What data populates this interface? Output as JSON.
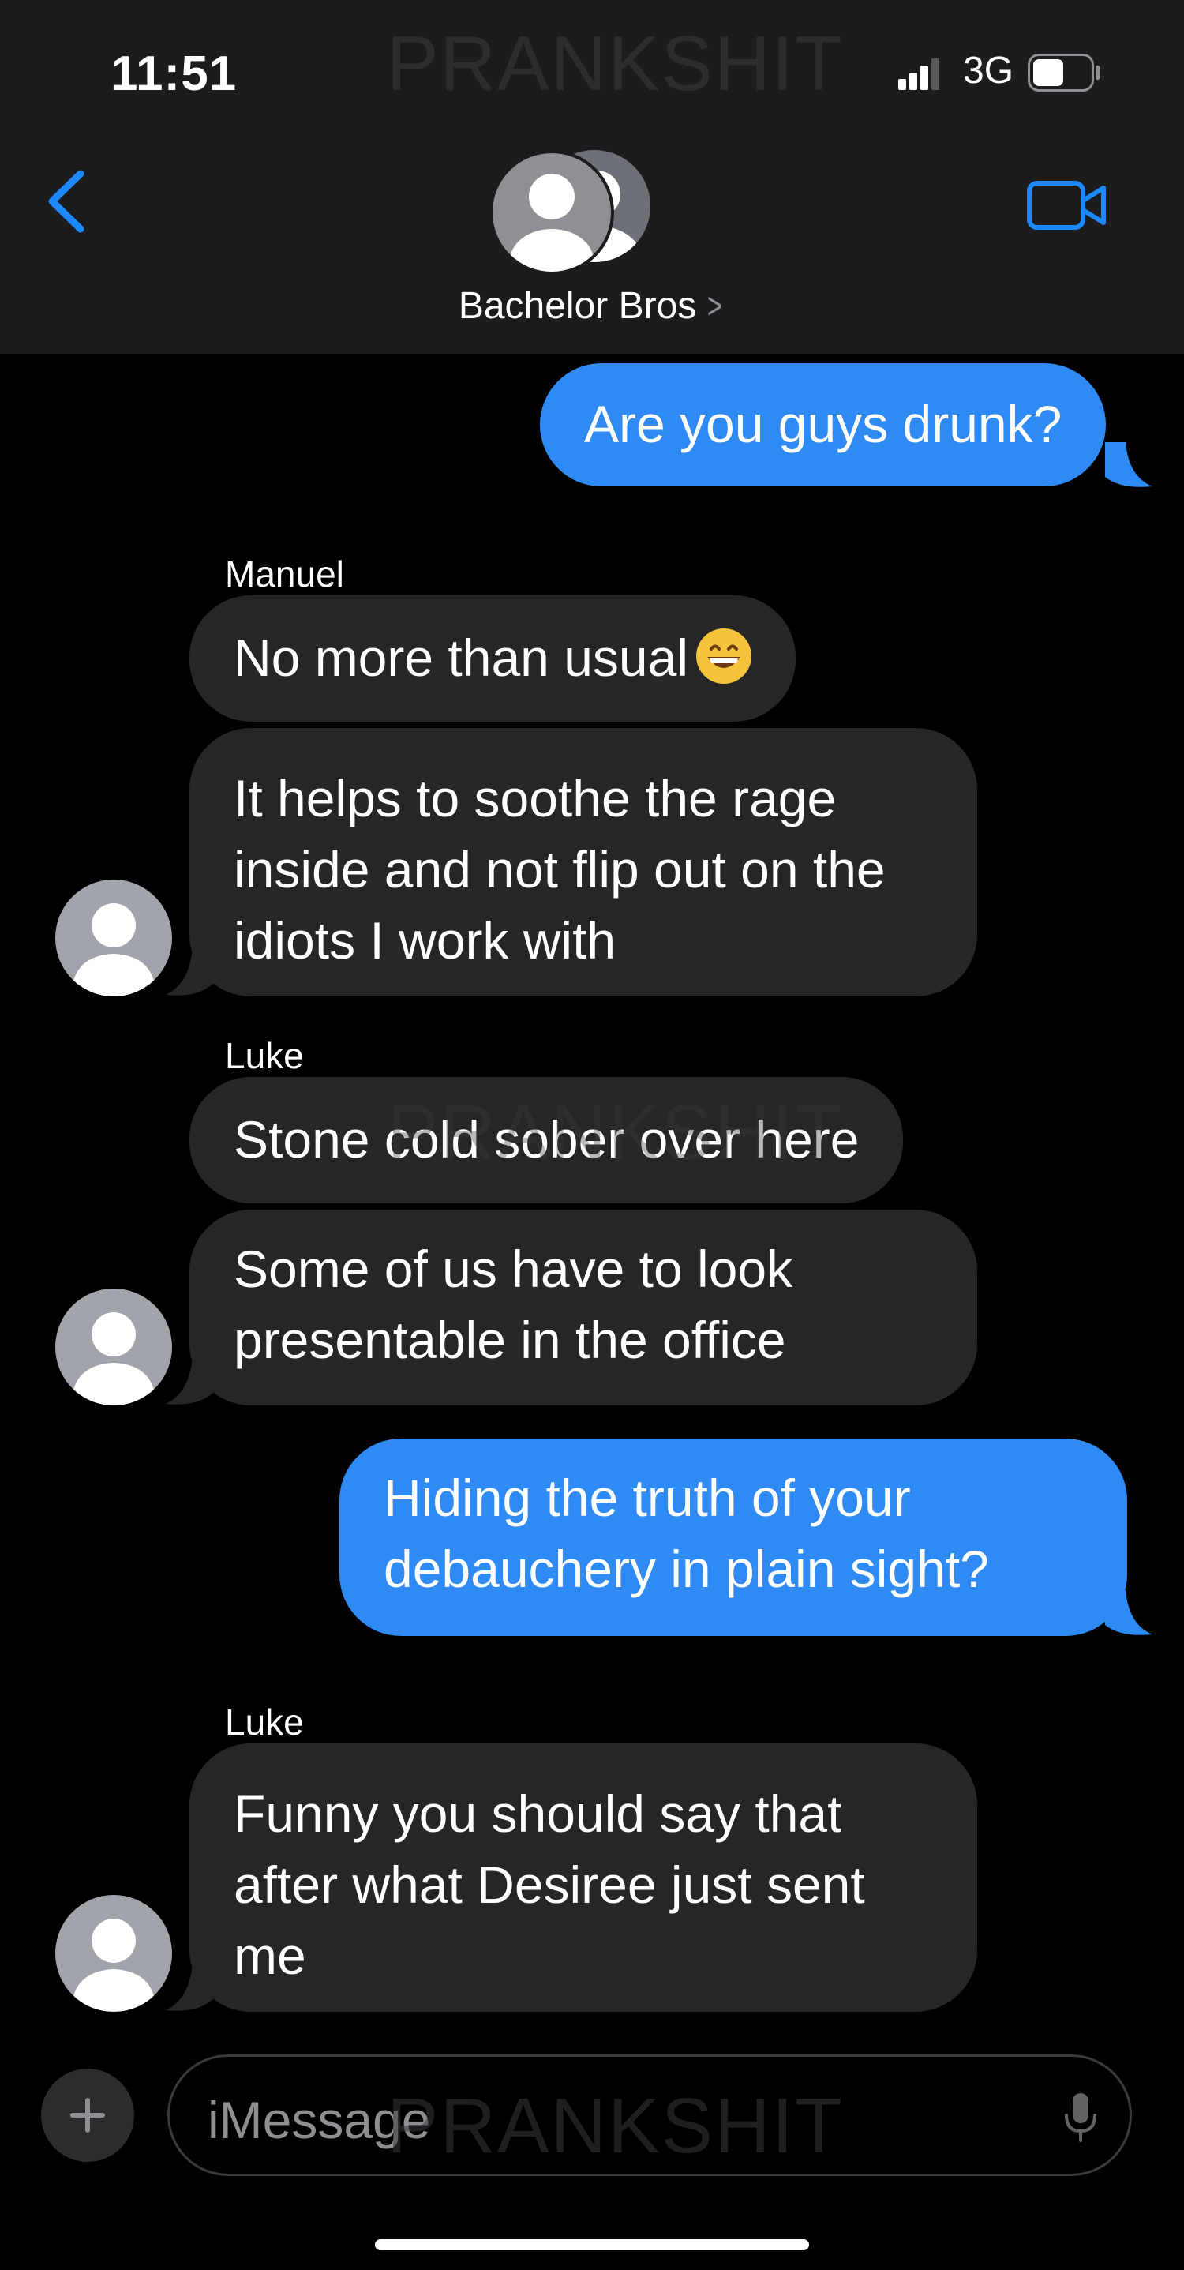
{
  "status_bar": {
    "time": "11:51",
    "network": "3G",
    "watermark": "PRANKSHIT"
  },
  "header": {
    "group_name": "Bachelor Bros",
    "chevron": ">",
    "icons": [
      "back-chevron-icon",
      "video-camera-icon",
      "group-avatar-icon"
    ]
  },
  "messages": [
    {
      "direction": "out",
      "lines": [
        "Are you guys drunk?"
      ]
    },
    {
      "direction": "in",
      "sender": "Manuel",
      "lines": [
        "No more than usual"
      ],
      "emoji": "grinning-face-icon"
    },
    {
      "direction": "in",
      "lines": [
        "It helps to soothe the rage",
        "inside and not flip out on the",
        "idiots I work with"
      ]
    },
    {
      "direction": "in",
      "sender": "Luke",
      "lines": [
        "Stone cold sober over here"
      ]
    },
    {
      "direction": "in",
      "lines": [
        "Some of us have to look",
        "presentable in the office"
      ]
    },
    {
      "direction": "out",
      "lines": [
        "Hiding the truth of your",
        "debauchery in plain sight?"
      ]
    },
    {
      "direction": "in",
      "sender": "Luke",
      "lines": [
        "Funny you should say that",
        "after what Desiree just sent",
        "me"
      ]
    }
  ],
  "input_bar": {
    "placeholder": "iMessage",
    "icons": [
      "plus-icon",
      "microphone-icon"
    ]
  },
  "colors": {
    "header_bg": "#1c1c1e",
    "outgoing_bubble": "#2f8bf3",
    "incoming_bubble": "#262628",
    "accent": "#1e88ff"
  }
}
